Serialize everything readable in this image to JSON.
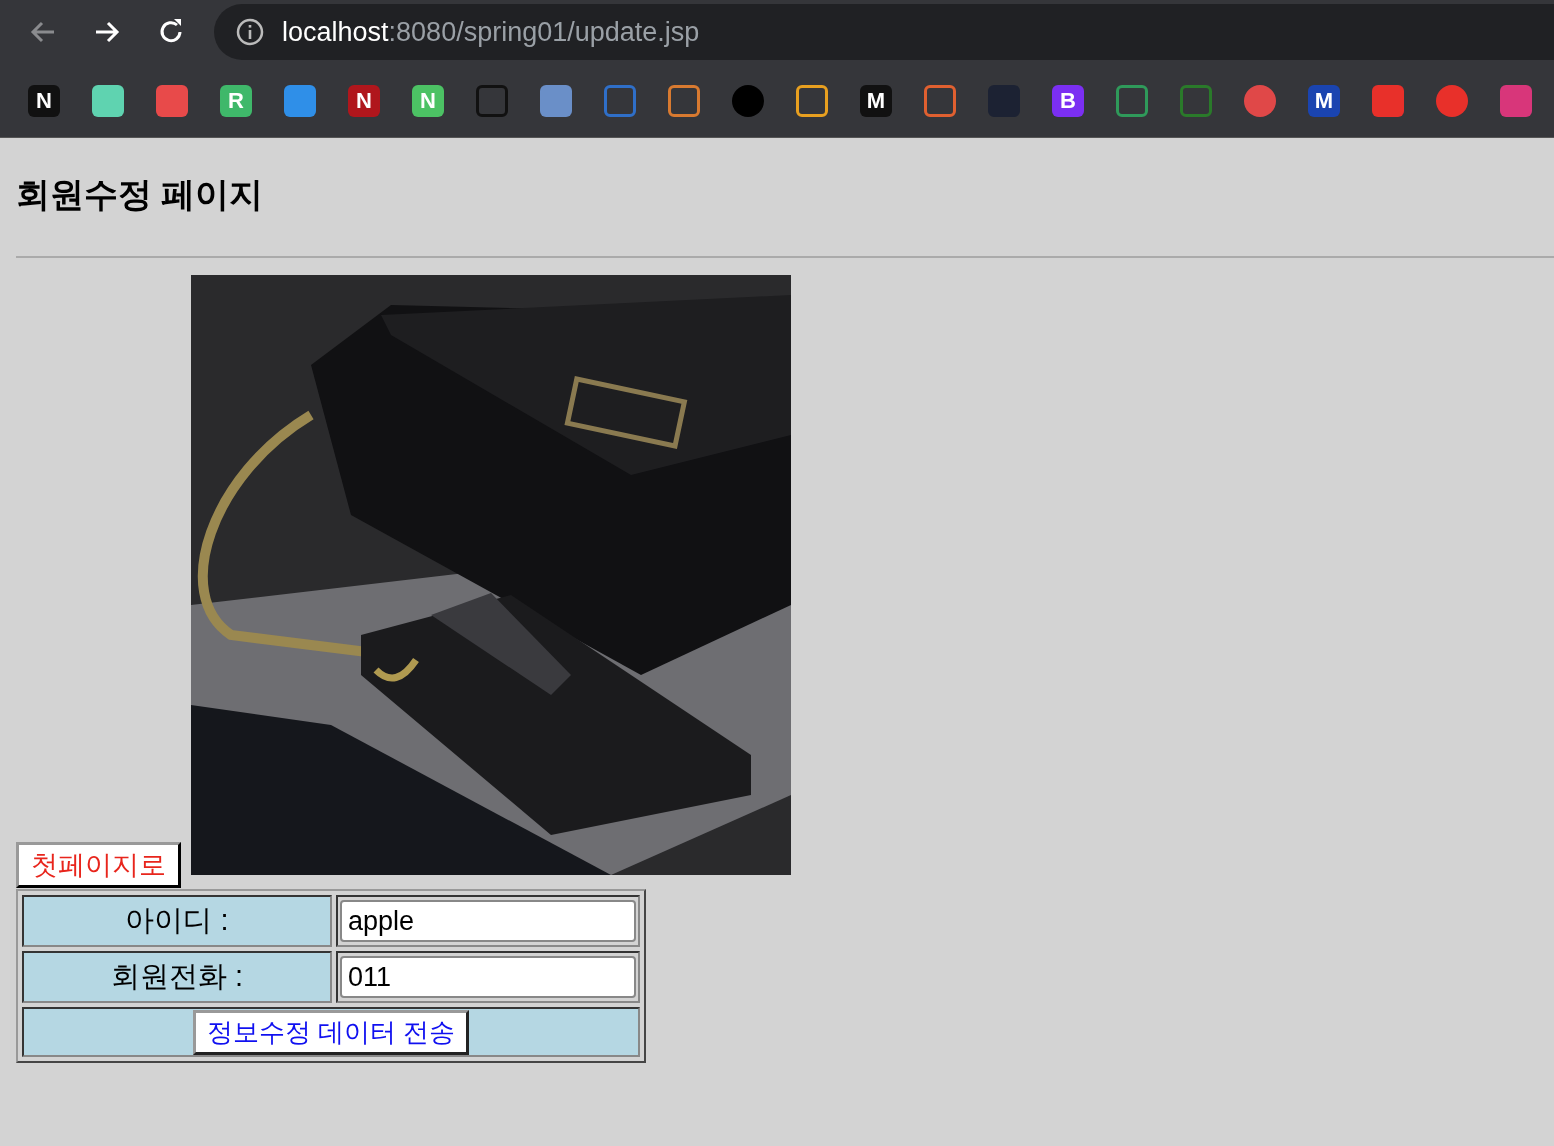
{
  "browser": {
    "url_host": "localhost",
    "url_path": ":8080/spring01/update.jsp",
    "bookmarks": [
      {
        "kind": "text",
        "glyph": "N",
        "color": "#111111"
      },
      {
        "kind": "tile",
        "color": "#5fd3b0"
      },
      {
        "kind": "tile",
        "color": "#e84a4a"
      },
      {
        "kind": "text",
        "glyph": "R",
        "color": "#3fb86a"
      },
      {
        "kind": "tile",
        "color": "#2f8fe8"
      },
      {
        "kind": "text",
        "glyph": "N",
        "color": "#b0161c"
      },
      {
        "kind": "text",
        "glyph": "N",
        "color": "#4cc264"
      },
      {
        "kind": "outline",
        "color": "#111111"
      },
      {
        "kind": "tile",
        "color": "#6a8fc8"
      },
      {
        "kind": "outline",
        "color": "#2f6fc8"
      },
      {
        "kind": "outline",
        "color": "#d87a30"
      },
      {
        "kind": "circle",
        "color": "#000000"
      },
      {
        "kind": "outline",
        "color": "#e8a020"
      },
      {
        "kind": "text",
        "glyph": "M",
        "color": "#111111"
      },
      {
        "kind": "outline",
        "color": "#e06030"
      },
      {
        "kind": "tile",
        "color": "#1c2233"
      },
      {
        "kind": "text",
        "glyph": "B",
        "color": "#7b2ff2"
      },
      {
        "kind": "outline",
        "color": "#2f9a5a"
      },
      {
        "kind": "outline",
        "color": "#2a7a2a"
      },
      {
        "kind": "circle",
        "color": "#e04848"
      },
      {
        "kind": "text",
        "glyph": "M",
        "color": "#1a44b0"
      },
      {
        "kind": "tile",
        "color": "#e8302a"
      },
      {
        "kind": "circle",
        "color": "#e8302a"
      },
      {
        "kind": "tile",
        "color": "#d8367a"
      }
    ]
  },
  "heading": "회원수정 페이지",
  "home_button": "첫페이지로",
  "form": {
    "fields": [
      {
        "label": "아이디 :",
        "value": "apple"
      },
      {
        "label": "회원전화 :",
        "value": "011"
      }
    ],
    "submit": "정보수정 데이터 전송"
  }
}
